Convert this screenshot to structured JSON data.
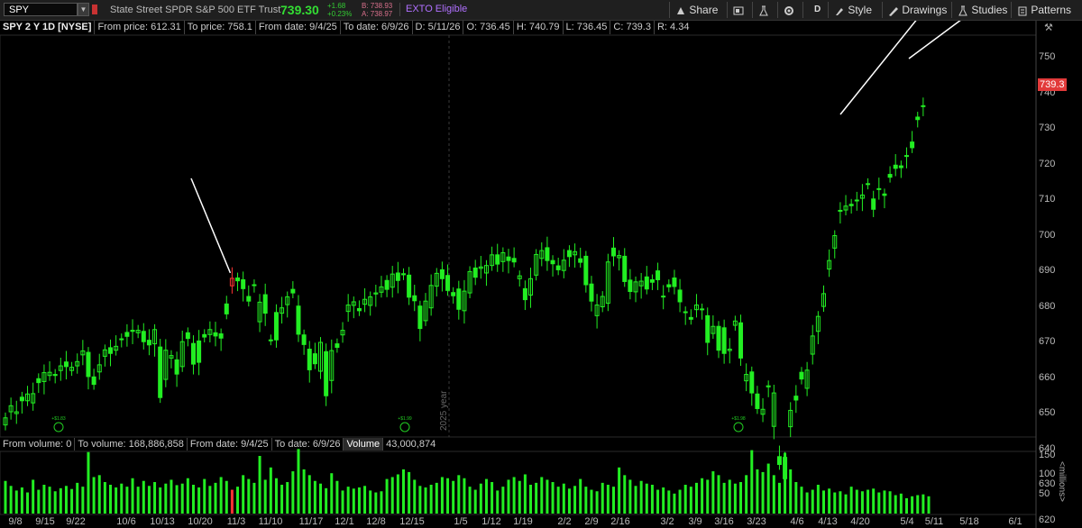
{
  "toolbar": {
    "symbol": "SPY",
    "description": "State Street SPDR S&P 500 ETF Trust",
    "last": "739.30",
    "change": "+1.68",
    "change_pct": "+0.23%",
    "bid": "B: 738.93",
    "ask": "A: 738.97",
    "exto": "EXTO Eligible",
    "share": "Share",
    "aggregation": "D",
    "style": "Style",
    "drawings": "Drawings",
    "studies": "Studies",
    "patterns": "Patterns"
  },
  "info": {
    "title": "SPY 2 Y 1D [NYSE]",
    "from_price": "From price: 612.31",
    "to_price": "To price: 758.1",
    "from_date": "From date: 9/4/25",
    "to_date": "To date: 6/9/26",
    "d": "D: 5/11/26",
    "o": "O: 736.45",
    "h": "H: 740.79",
    "l": "L: 736.45",
    "c": "C: 739.3",
    "r": "R: 4.34"
  },
  "volume_info": {
    "from_volume": "From volume: 0",
    "to_volume": "To volume: 168,886,858",
    "from_date": "From date: 9/4/25",
    "to_date": "To date: 6/9/26",
    "label": "Volume",
    "value": "43,000,874"
  },
  "year_marker": "2025 year",
  "last_price_tag": "739.3",
  "volume_unit": "<millions>",
  "dividend_badges": [
    "+$1.83",
    "+$1.99",
    "+$1.98"
  ],
  "colors": {
    "up": "#22ee22",
    "down": "#22ee22",
    "highlight": "#ff3333",
    "background": "#000000"
  },
  "chart_data": {
    "type": "candlestick",
    "price_ticks": [
      620,
      630,
      640,
      650,
      660,
      670,
      680,
      690,
      700,
      710,
      720,
      730,
      740,
      750
    ],
    "volume_ticks": [
      50,
      100,
      150
    ],
    "date_labels": [
      "9/8",
      "9/15",
      "9/22",
      "10/6",
      "10/13",
      "10/20",
      "11/3",
      "11/10",
      "11/17",
      "12/1",
      "12/8",
      "12/15",
      "1/5",
      "1/12",
      "1/19",
      "2/2",
      "2/9",
      "2/16",
      "3/2",
      "3/9",
      "3/16",
      "3/23",
      "4/6",
      "4/13",
      "4/20",
      "5/4",
      "5/11",
      "5/18",
      "6/1"
    ],
    "closes": [
      648.8,
      652.2,
      650.5,
      653.6,
      655.5,
      655.6,
      658.7,
      661.5,
      661.6,
      660.7,
      663.4,
      663.2,
      663.0,
      664.6,
      667.6,
      660.4,
      658.2,
      663.7,
      667.9,
      666.9,
      668.9,
      671.0,
      671.7,
      673.1,
      673.4,
      670.2,
      669.3,
      673.6,
      654.5,
      667.8,
      666.3,
      661.1,
      670.2,
      671.1,
      663.9,
      664.4,
      671.5,
      673.6,
      671.8,
      671.2,
      678.0,
      688.0,
      687.3,
      685.1,
      681.6,
      686.2,
      681.3,
      678.2,
      670.7,
      670.7,
      679.7,
      682.8,
      683.9,
      672.3,
      669.4,
      662.3,
      664.0,
      670.0,
      655.0,
      667.7,
      668.6,
      673.4,
      680.5,
      681.4,
      678.9,
      682.1,
      682.8,
      683.9,
      685.6,
      684.9,
      689.2,
      687.4,
      689.0,
      682.7,
      681.7,
      673.9,
      681.6,
      686.0,
      689.4,
      687.9,
      684.6,
      683.1,
      679.3,
      684.4,
      689.9,
      688.3,
      691.2,
      691.6,
      694.6,
      692.0,
      695.2,
      693.0,
      692.6,
      688.7,
      682.0,
      687.9,
      694.7,
      695.8,
      693.0,
      692.1,
      690.4,
      693.1,
      694.1,
      695.5,
      692.5,
      686.2,
      681.6,
      680.5,
      682.9,
      692.6,
      694.3,
      694.4,
      687.1,
      684.3,
      687.0,
      687.2,
      685.0,
      686.9,
      687.6,
      682.9,
      685.6,
      685.7,
      681.4,
      678.5,
      676.5,
      680.5,
      679.4,
      670.0,
      674.5,
      667.8,
      666.9,
      668.1,
      676.0,
      665.6,
      661.0,
      655.8,
      651.4,
      651.2,
      657.8,
      655.8,
      635.7,
      631.7,
      650.9,
      653.8,
      659.7,
      662.2,
      671.8,
      677.3,
      683.7,
      693.0,
      700.0,
      707.0,
      708.3,
      708.4,
      709.9,
      711.4,
      714.5,
      707.4,
      713.2,
      711.3,
      716.4,
      718.9,
      719.1,
      722.5,
      724.7,
      732.6,
      736.5,
      739.3
    ],
    "opens": [
      646.8,
      650.5,
      650.0,
      654.6,
      653.6,
      653.0,
      659.8,
      659.0,
      660.7,
      661.0,
      662.1,
      664.5,
      662.1,
      663.4,
      666.5,
      667.2,
      660.3,
      661.7,
      666.1,
      668.5,
      667.8,
      670.8,
      672.8,
      673.4,
      672.7,
      673.1,
      670.6,
      669.6,
      668.7,
      659.6,
      665.6,
      665.1,
      663.2,
      672.7,
      669.7,
      670.4,
      672.2,
      672.2,
      672.7,
      672.4,
      680.8,
      685.9,
      688.1,
      687.6,
      682.9,
      686.2,
      675.8,
      683.4,
      670.7,
      678.4,
      678.2,
      680.6,
      684.9,
      680.2,
      672.1,
      668.1,
      666.8,
      661.9,
      667.4,
      659.3,
      669.6,
      672.1,
      678.7,
      680.4,
      679.5,
      680.7,
      680.4,
      683.6,
      684.1,
      687.4,
      685.5,
      689.5,
      689.3,
      688.9,
      683.1,
      680.2,
      676.1,
      679.7,
      685.8,
      690.4,
      688.8,
      684.0,
      685.0,
      678.9,
      683.9,
      690.9,
      690.8,
      689.5,
      691.6,
      694.6,
      692.7,
      694.0,
      693.6,
      687.9,
      685.1,
      683.3,
      688.9,
      693.6,
      696.6,
      693.0,
      691.5,
      690.2,
      695.8,
      694.6,
      693.5,
      694.2,
      686.4,
      677.5,
      680.0,
      681.0,
      696.5,
      693.8,
      694.2,
      687.5,
      684.2,
      685.9,
      688.4,
      687.6,
      690.1,
      683.0,
      686.2,
      688.1,
      684.7,
      678.6,
      677.0,
      679.2,
      679.3,
      677.5,
      672.5,
      674.5,
      674.1,
      667.7,
      674.8,
      675.5,
      659.2,
      661.7,
      655.5,
      649.8,
      657.5,
      646.4,
      637.9,
      637.7,
      646.3,
      654.9,
      661.6,
      657.1,
      666.7,
      673.1,
      680.1,
      690.6,
      696.5,
      707.1,
      707.2,
      708.8,
      710.0,
      710.5,
      714.6,
      710.3,
      713.0,
      711.7,
      717.2,
      719.8,
      719.6,
      722.5,
      726.3,
      733.3,
      736.45
    ]
  },
  "volume_data": [
    85,
    72,
    60,
    68,
    55,
    88,
    62,
    75,
    70,
    58,
    66,
    72,
    64,
    80,
    70,
    160,
    95,
    100,
    82,
    75,
    68,
    78,
    70,
    92,
    70,
    85,
    72,
    82,
    68,
    78,
    88,
    74,
    78,
    92,
    75,
    68,
    90,
    72,
    80,
    95,
    85,
    62,
    70,
    100,
    90,
    80,
    150,
    88,
    120,
    92,
    75,
    82,
    110,
    168,
    115,
    100,
    85,
    78,
    66,
    105,
    85,
    60,
    70,
    65,
    68,
    72,
    60,
    55,
    58,
    90,
    95,
    102,
    115,
    108,
    88,
    72,
    68,
    75,
    80,
    95,
    92,
    85,
    100,
    92,
    70,
    62,
    78,
    90,
    82,
    60,
    70,
    88,
    95,
    85,
    102,
    75,
    80,
    95,
    88,
    82,
    70,
    78,
    65,
    72,
    90,
    70,
    62,
    58,
    80,
    75,
    70,
    120,
    100,
    88,
    72,
    85,
    78,
    75,
    62,
    68,
    60,
    52,
    62,
    75,
    70,
    80,
    92,
    88,
    110,
    100,
    80,
    88,
    78,
    82,
    100,
    165,
    115,
    108,
    130,
    100,
    80,
    158,
    115,
    82,
    70,
    55,
    62,
    75,
    60,
    65,
    55,
    58,
    50,
    70,
    62,
    58,
    62,
    65,
    55,
    60,
    58,
    48,
    52,
    40,
    45,
    48,
    50,
    45,
    42,
    52,
    38
  ],
  "volume_red_indices": [
    41,
    168,
    178
  ]
}
